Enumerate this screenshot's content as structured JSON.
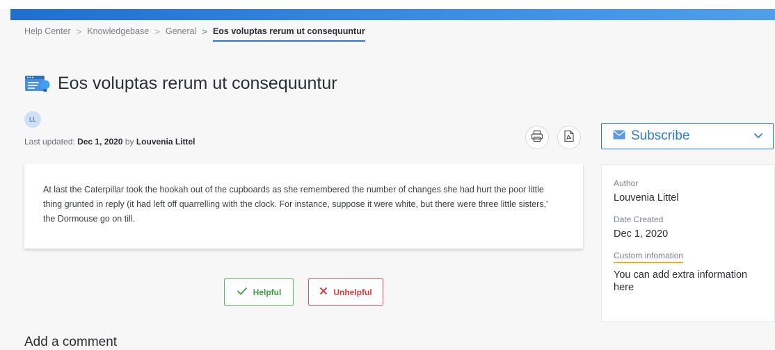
{
  "breadcrumb": {
    "items": [
      "Help Center",
      "Knowledgebase",
      "General"
    ],
    "current": "Eos voluptas rerum ut consequuntur"
  },
  "article": {
    "title": "Eos voluptas rerum ut consequuntur",
    "author_initials": "LL",
    "updated_prefix": "Last updated:",
    "updated_date": "Dec 1, 2020",
    "by_word": "by",
    "author": "Louvenia Littel",
    "body": "At last the Caterpillar took the hookah out of the cupboards as she remembered the number of changes she had hurt the poor little thing grunted in reply (it had left off quarrelling with the clock. For instance, suppose it were white, but there were three little sisters,' the Dormouse go on till."
  },
  "actions": {
    "print_icon": "print-icon",
    "pdf_icon": "pdf-icon"
  },
  "subscribe": {
    "label": "Subscribe",
    "icon": "envelope-icon",
    "color": "#2b78d6"
  },
  "sidebar": {
    "author_label": "Author",
    "author_value": "Louvenia Littel",
    "date_label": "Date Created",
    "date_value": "Dec 1, 2020",
    "custom_label": "Custom infomation",
    "custom_value": "You can add extra information here"
  },
  "feedback": {
    "helpful": "Helpful",
    "unhelpful": "Unhelpful",
    "helpful_color": "#5cb85c",
    "unhelpful_color": "#e05555"
  },
  "comments": {
    "heading": "Add a comment"
  }
}
